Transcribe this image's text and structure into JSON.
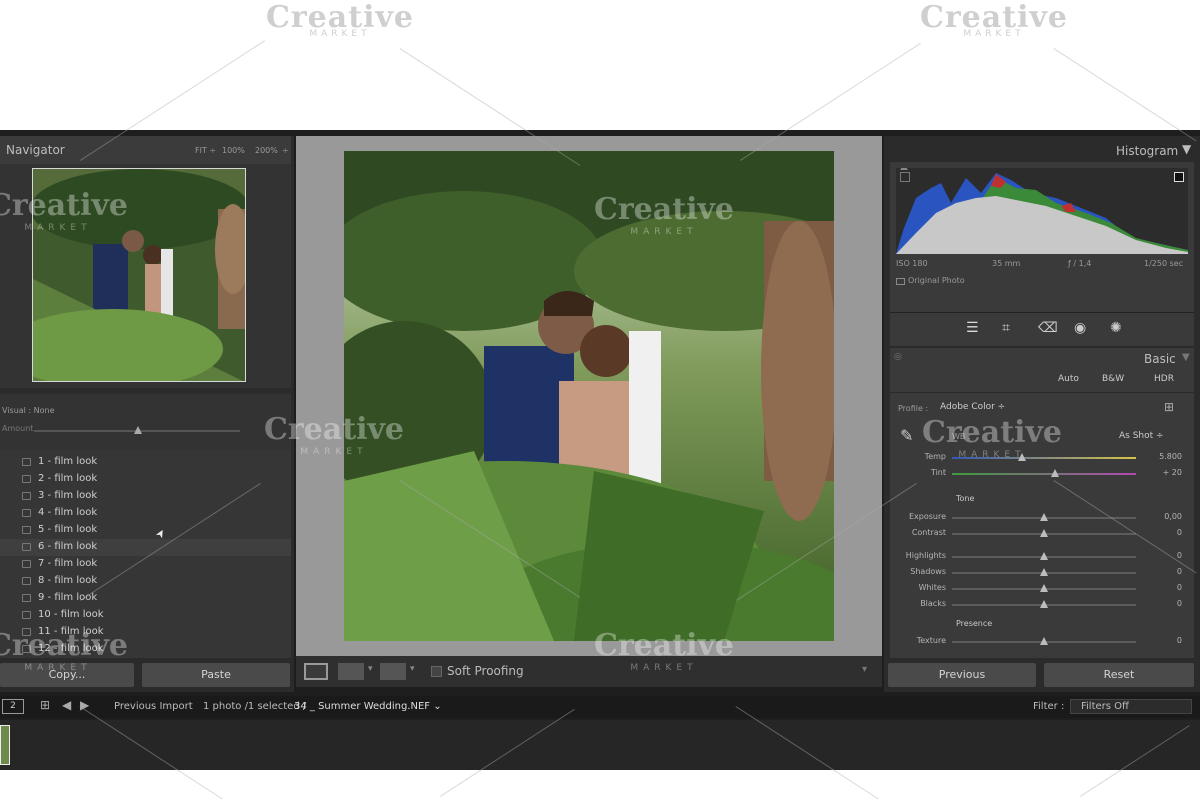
{
  "watermark": {
    "brand": "Creative",
    "sub": "MARKET"
  },
  "navigator": {
    "title": "Navigator",
    "zoom_options": [
      "FIT ÷",
      "100%",
      "200%",
      "÷"
    ]
  },
  "presets_panel": {
    "visual_label": "Visual : None",
    "amount_label": "Amount",
    "items": [
      "1 - film look",
      "2 - film look",
      "3 - film look",
      "4 - film look",
      "5 - film look",
      "6 - film look",
      "7 - film look",
      "8 - film look",
      "9 - film look",
      "10 - film look",
      "11 - film look",
      "12 - film look"
    ],
    "copy_label": "Copy...",
    "paste_label": "Paste"
  },
  "toolbar": {
    "soft_proofing_label": "Soft Proofing"
  },
  "histogram": {
    "title": "Histogram",
    "iso": "ISO 180",
    "focal": "35 mm",
    "aperture": "ƒ / 1,4",
    "shutter": "1/250 sec",
    "original_photo_label": "Original Photo"
  },
  "basic": {
    "title": "Basic",
    "auto_label": "Auto",
    "bw_label": "B&W",
    "hdr_label": "HDR",
    "profile_label": "Profile :",
    "profile_value": "Adobe Color ÷",
    "wb_label": "WB :",
    "wb_value": "As Shot ÷",
    "temp": {
      "label": "Temp",
      "value": "5.800",
      "fraction": 0.38
    },
    "tint": {
      "label": "Tint",
      "value": "+ 20",
      "fraction": 0.56
    },
    "tone_label": "Tone",
    "tone_sliders": [
      {
        "label": "Exposure",
        "value": "0,00",
        "fraction": 0.5
      },
      {
        "label": "Contrast",
        "value": "0",
        "fraction": 0.5
      },
      {
        "label": "Highlights",
        "value": "0",
        "fraction": 0.5
      },
      {
        "label": "Shadows",
        "value": "0",
        "fraction": 0.5
      },
      {
        "label": "Whites",
        "value": "0",
        "fraction": 0.5
      },
      {
        "label": "Blacks",
        "value": "0",
        "fraction": 0.5
      }
    ],
    "presence_label": "Presence",
    "texture": {
      "label": "Texture",
      "value": "0",
      "fraction": 0.5
    },
    "previous_label": "Previous",
    "reset_label": "Reset"
  },
  "filmbar": {
    "monitor_num": "2",
    "source": "Previous Import",
    "count_text": "1 photo /1 selected /",
    "filename": "34 _ Summer Wedding.NEF ⌄",
    "filter_label": "Filter :",
    "filter_value": "Filters Off"
  },
  "colors": {
    "accent": "#bdbdbd",
    "panel": "#3a3a3a",
    "bg": "#1e1e1e"
  }
}
